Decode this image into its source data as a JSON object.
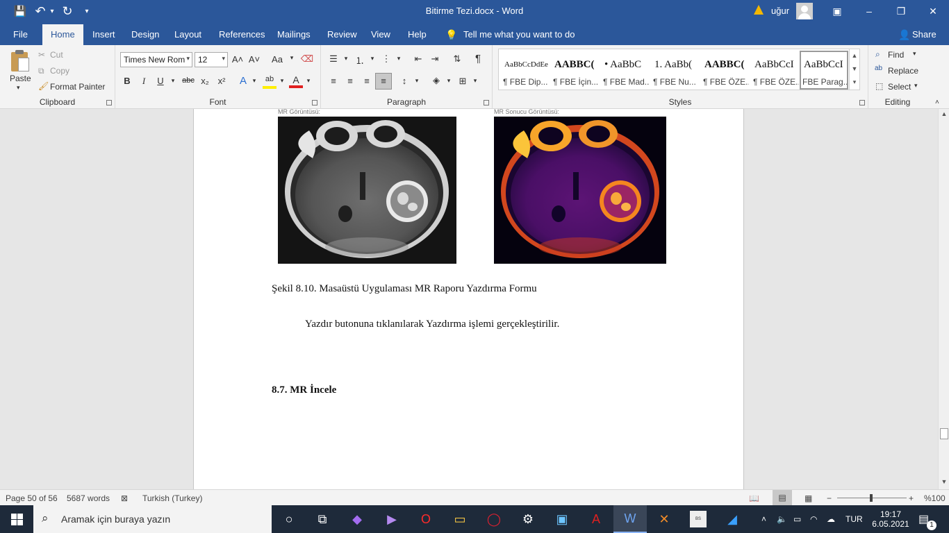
{
  "window": {
    "title": "Bitirme Tezi.docx  -  Word",
    "user": "uğur",
    "minimize_icon": "–",
    "restore_icon": "❐",
    "close_icon": "✕",
    "ribbon_display_icon": "▣"
  },
  "quick_access": {
    "save_icon": "💾",
    "undo_icon": "↶",
    "undo_dropdown": "▾",
    "redo_icon": "↻",
    "customize_icon": "▾"
  },
  "tabs": [
    "File",
    "Home",
    "Insert",
    "Design",
    "Layout",
    "References",
    "Mailings",
    "Review",
    "View",
    "Help"
  ],
  "tell_me": "Tell me what you want to do",
  "share": "Share",
  "clipboard": {
    "paste": "Paste",
    "cut": "Cut",
    "copy": "Copy",
    "format_painter": "Format Painter",
    "label": "Clipboard"
  },
  "font": {
    "name": "Times New Rom",
    "size": "12",
    "label": "Font",
    "bold": "B",
    "italic": "I",
    "underline": "U",
    "strike": "abc",
    "subscript": "x₂",
    "superscript": "x²",
    "grow": "A˄",
    "shrink": "A˅",
    "change_case": "Aa",
    "effects": "A",
    "highlight": "ab",
    "color": "A"
  },
  "paragraph": {
    "label": "Paragraph",
    "pilcrow": "¶"
  },
  "styles": {
    "label": "Styles",
    "items": [
      {
        "preview": "AaBbCcDdEe",
        "name": "¶ FBE Dip..."
      },
      {
        "preview": "AABBC(",
        "name": "¶ FBE İçin..."
      },
      {
        "preview": "• AaBbC",
        "name": "¶ FBE Mad..."
      },
      {
        "preview": "1.  AaBb(",
        "name": "¶ FBE Nu..."
      },
      {
        "preview": "AABBC(",
        "name": "¶ FBE ÖZE..."
      },
      {
        "preview": "AaBbCcI",
        "name": "¶ FBE ÖZE..."
      },
      {
        "preview": "AaBbCcI",
        "name": "FBE Parag..."
      }
    ]
  },
  "editing": {
    "label": "Editing",
    "find": "Find",
    "replace": "Replace",
    "select": "Select"
  },
  "document": {
    "caption_left": "MR Görüntüsü:",
    "caption_right": "MR Sonucu Görüntüsü:",
    "figure_caption": "Şekil 8.10. Masaüstü Uygulaması MR Raporu Yazdırma Formu",
    "body_text": "Yazdır butonuna tıklanılarak Yazdırma işlemi gerçekleştirilir.",
    "heading": "8.7. MR İncele"
  },
  "status": {
    "page": "Page 50 of 56",
    "words": "5687 words",
    "language": "Turkish (Turkey)",
    "zoom": "%100",
    "zoom_minus": "−",
    "zoom_plus": "+"
  },
  "taskbar": {
    "search_placeholder": "Aramak için buraya yazın",
    "language": "TUR",
    "time": "19:17",
    "date": "6.05.2021",
    "notification_count": "1"
  },
  "colors": {
    "word_blue": "#2b579a",
    "ribbon_bg": "#f3f3f3",
    "taskbar_bg": "#1e2a3a"
  }
}
